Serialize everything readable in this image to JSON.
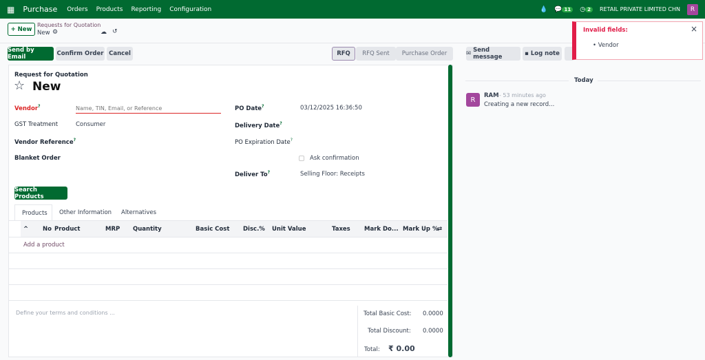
{
  "nav": {
    "app": "Purchase",
    "menu": [
      "Orders",
      "Products",
      "Reporting",
      "Configuration"
    ],
    "messages_count": "11",
    "activities_count": "2",
    "company": "RETAIL PRIVATE LIMITED CHN",
    "avatar": "R"
  },
  "control": {
    "new_label": "+ New",
    "breadcrumb": "Requests for Quotation",
    "record": "New"
  },
  "actions": {
    "send_email": "Send by Email",
    "confirm": "Confirm Order",
    "cancel": "Cancel"
  },
  "status": [
    "RFQ",
    "RFQ Sent",
    "Purchase Order"
  ],
  "chatter": {
    "send_message": "Send message",
    "log_note": "Log note",
    "today": "Today",
    "author": "RAM",
    "time": "- 53 minutes ago",
    "message": "Creating a new record...",
    "avatar": "R"
  },
  "toast": {
    "title": "Invalid fields:",
    "items": [
      "Vendor"
    ],
    "close": "×"
  },
  "form": {
    "subtitle": "Request for Quotation",
    "title": "New",
    "vendor_label": "Vendor",
    "vendor_placeholder": "Name, TIN, Email, or Reference",
    "gst_label": "GST Treatment",
    "gst_value": "Consumer",
    "vendor_ref_label": "Vendor Reference",
    "blanket_label": "Blanket Order",
    "po_date_label": "PO Date",
    "po_date_value": "03/12/2025 16:36:50",
    "delivery_label": "Delivery Date",
    "expiration_label": "PO Expiration Date",
    "ask_confirm": "Ask confirmation",
    "deliver_to_label": "Deliver To",
    "deliver_to_value": "Selling Floor: Receipts",
    "search_products": "Search Products"
  },
  "tabs": [
    "Products",
    "Other Information",
    "Alternatives"
  ],
  "table": {
    "headers": [
      "No",
      "Product",
      "MRP",
      "Quantity",
      "Basic Cost",
      "Disc.%",
      "Unit Value",
      "Taxes",
      "Mark Do...",
      "Mark Up %"
    ],
    "add": "Add a product"
  },
  "footer": {
    "terms_placeholder": "Define your terms and conditions ...",
    "basic_cost_label": "Total Basic Cost:",
    "basic_cost": "0.0000",
    "discount_label": "Total Discount:",
    "discount": "0.0000",
    "total_label": "Total:",
    "total": "₹ 0.00"
  }
}
